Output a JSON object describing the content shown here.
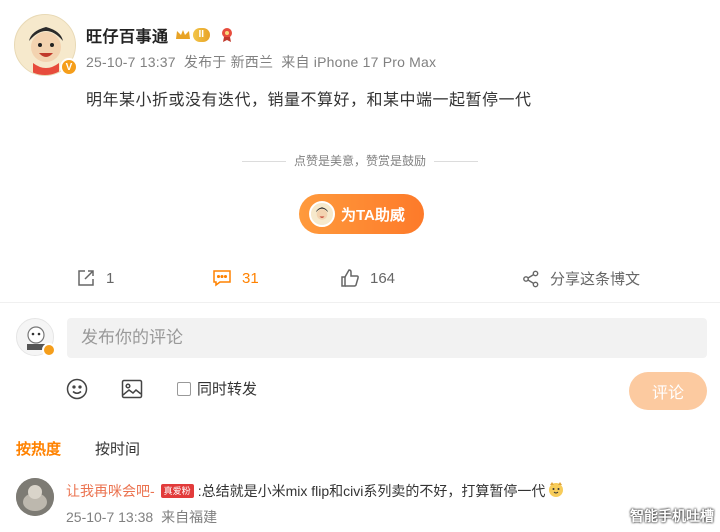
{
  "post": {
    "username": "旺仔百事通",
    "level_badge": "II",
    "timestamp": "25-10-7 13:37",
    "location": "发布于 新西兰",
    "device": "来自 iPhone 17 Pro Max",
    "content": "明年某小折或没有迭代，销量不算好，和某中端一起暂停一代"
  },
  "like_hint": "点赞是美意，赞赏是鼓励",
  "cheer_button": {
    "label": "为TA助威"
  },
  "actions": {
    "repost_count": "1",
    "comment_count": "31",
    "like_count": "164",
    "share_label": "分享这条博文"
  },
  "composer": {
    "placeholder": "发布你的评论",
    "repost_label": "同时转发",
    "submit_label": "评论"
  },
  "sort_tabs": [
    "按热度",
    "按时间"
  ],
  "comments": [
    {
      "user": "让我再咪会吧-",
      "badge": "真爱粉",
      "text": ":总结就是小米mix flip和civi系列卖的不好，打算暂停一代",
      "time": "25-10-7 13:38",
      "location": "来自福建"
    }
  ],
  "watermark": "智能手机吐槽",
  "colors": {
    "accent": "#ff8200",
    "username": "#eb7350",
    "submit_disabled": "#fccaa0"
  }
}
